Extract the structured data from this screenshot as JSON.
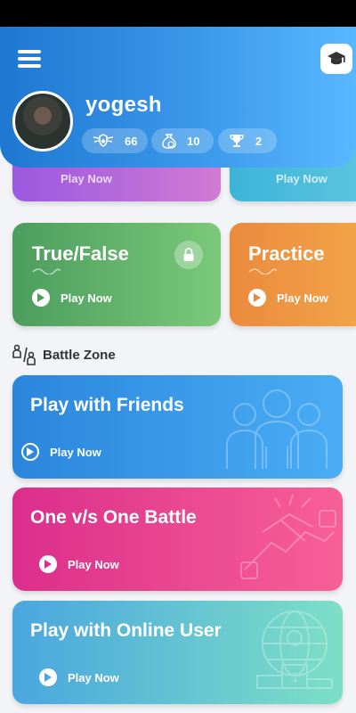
{
  "header": {
    "username": "yogesh",
    "stats": [
      {
        "icon": "badge-icon",
        "value": "66"
      },
      {
        "icon": "coin-bag-icon",
        "value": "10"
      },
      {
        "icon": "trophy-icon",
        "value": "2"
      }
    ]
  },
  "quiz_cards": {
    "peek_left_label": "Play Now",
    "peek_right_label": "Play Now",
    "true_false": {
      "title": "True/False",
      "play_label": "Play Now",
      "locked": true
    },
    "practice": {
      "title": "Practice",
      "play_label": "Play Now"
    }
  },
  "battle_zone": {
    "section_title": "Battle Zone",
    "cards": [
      {
        "title": "Play with Friends",
        "play_label": "Play Now"
      },
      {
        "title": "One v/s One Battle",
        "play_label": "Play Now"
      },
      {
        "title": "Play with Online User",
        "play_label": "Play Now"
      }
    ]
  },
  "colors": {
    "header_start": "#1e78d2",
    "header_end": "#58b8ff",
    "true_false": "#4c9c5e",
    "practice": "#ea8a3e",
    "friends": "#2a86dd",
    "one_v_one": "#db2e8c",
    "online": "#7ddfc6"
  }
}
